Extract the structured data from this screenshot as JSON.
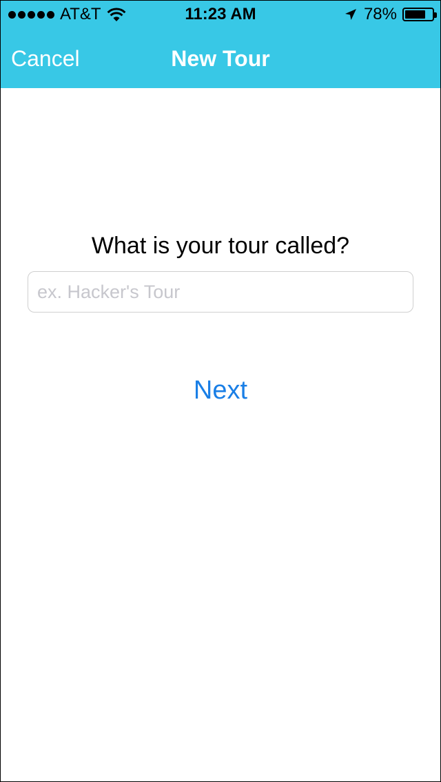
{
  "status_bar": {
    "carrier": "AT&T",
    "time": "11:23 AM",
    "battery_percent": "78%",
    "battery_level": 0.78,
    "signal_bars": 5,
    "icons": [
      "wifi-icon",
      "location-arrow-icon",
      "battery-icon"
    ]
  },
  "nav": {
    "cancel_label": "Cancel",
    "title": "New Tour"
  },
  "form": {
    "question": "What is your tour called?",
    "input_value": "",
    "input_placeholder": "ex. Hacker's Tour",
    "next_label": "Next"
  },
  "colors": {
    "nav_background": "#38c8e6",
    "nav_text": "#ffffff",
    "accent": "#1a7fe6",
    "placeholder": "#c7c7cd"
  }
}
